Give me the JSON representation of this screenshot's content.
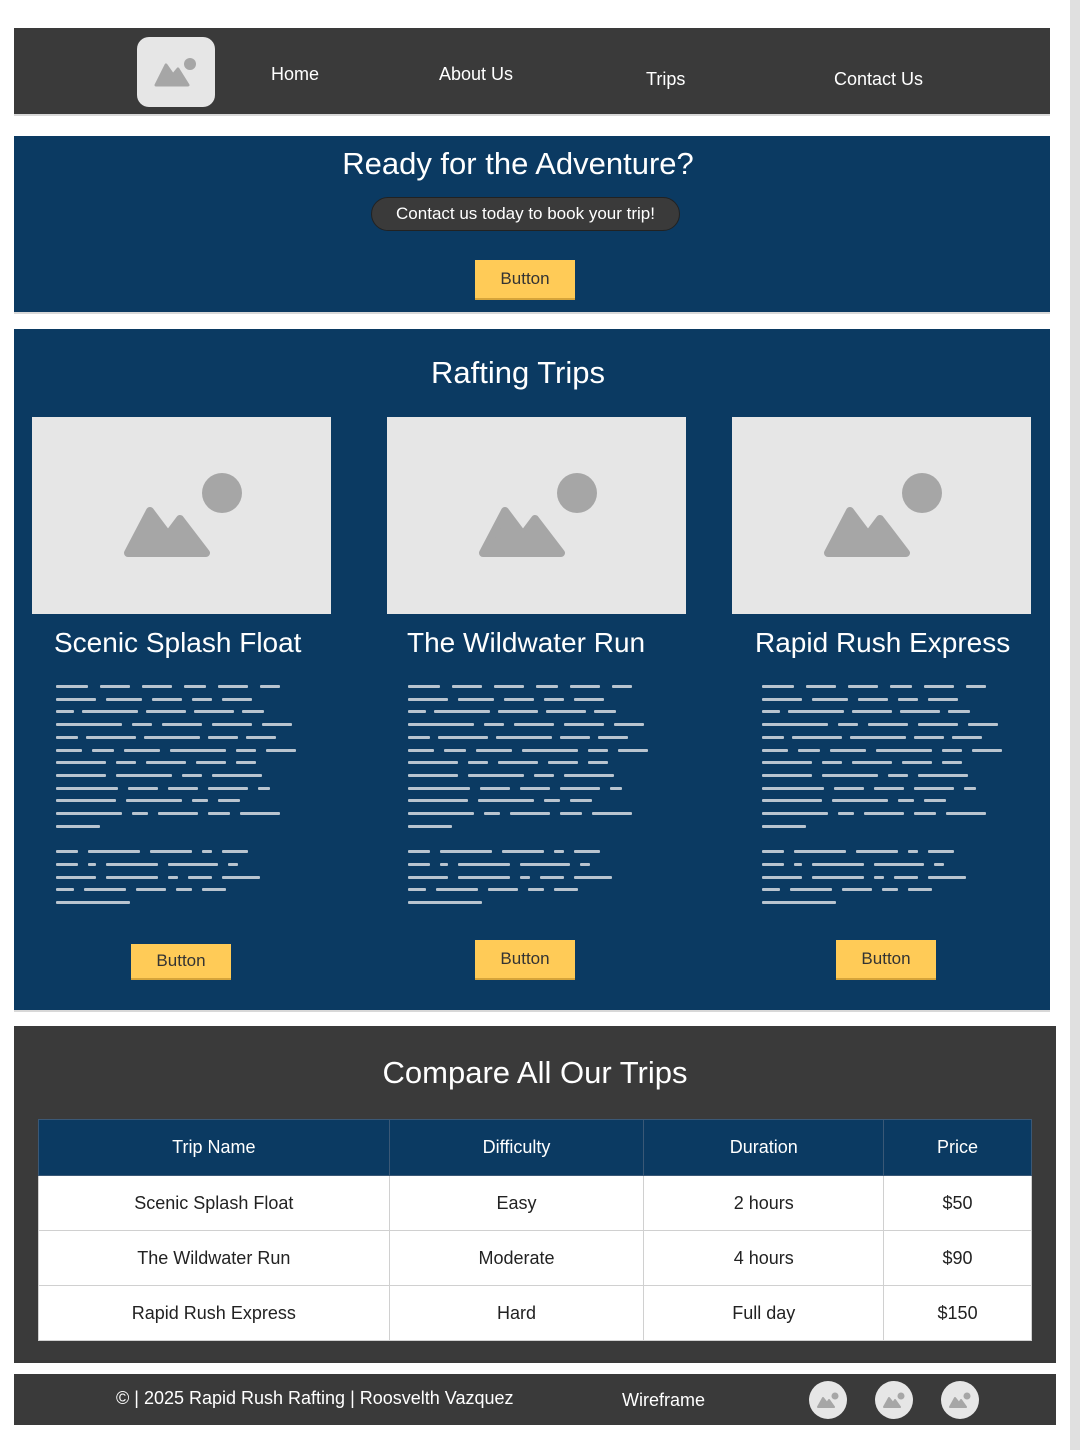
{
  "nav": {
    "logo_icon": "image-placeholder-icon",
    "links": [
      "Home",
      "About Us",
      "Trips",
      "Contact Us"
    ]
  },
  "hero": {
    "title": "Ready for the Adventure?",
    "subtitle": "Contact us today to book your trip!",
    "button_label": "Button"
  },
  "trips": {
    "title": "Rafting Trips",
    "cards": [
      {
        "title": "Scenic Splash Float",
        "image_icon": "image-placeholder-icon",
        "button_label": "Button"
      },
      {
        "title": "The Wildwater Run",
        "image_icon": "image-placeholder-icon",
        "button_label": "Button"
      },
      {
        "title": "Rapid Rush Express",
        "image_icon": "image-placeholder-icon",
        "button_label": "Button"
      }
    ]
  },
  "compare": {
    "title": "Compare All Our Trips",
    "headers": [
      "Trip Name",
      "Difficulty",
      "Duration",
      "Price"
    ],
    "rows": [
      [
        "Scenic Splash Float",
        "Easy",
        "2 hours",
        "$50"
      ],
      [
        "The Wildwater Run",
        "Moderate",
        "4 hours",
        "$90"
      ],
      [
        "Rapid Rush Express",
        "Hard",
        "Full day",
        "$150"
      ]
    ]
  },
  "footer": {
    "copyright": "© | 2025 Rapid Rush Rafting | Roosvelth Vazquez",
    "label": "Wireframe",
    "social_icons": [
      "image-placeholder-icon",
      "image-placeholder-icon",
      "image-placeholder-icon"
    ]
  },
  "colors": {
    "nav_bg": "#3a3a3a",
    "section_blue": "#0b3a62",
    "button_yellow": "#ffcb57",
    "placeholder_gray": "#e6e6e6"
  }
}
